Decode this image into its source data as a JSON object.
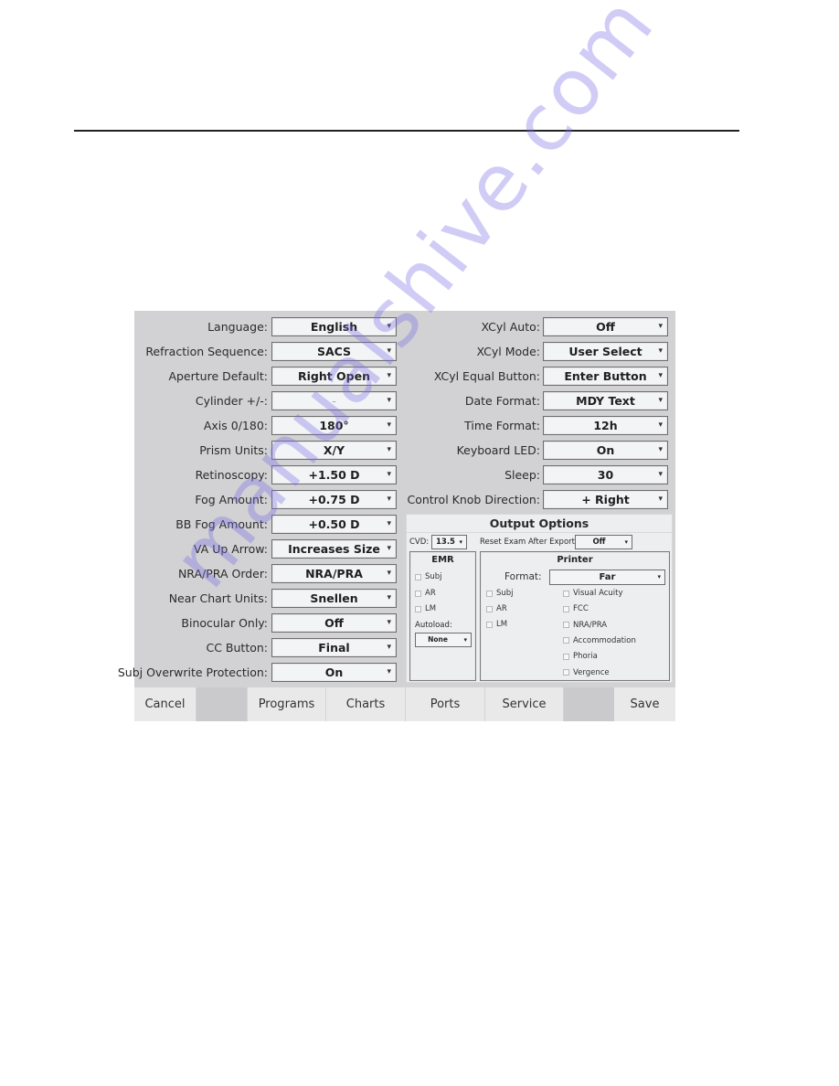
{
  "left_settings": [
    {
      "label": "Language:",
      "value": "English"
    },
    {
      "label": "Refraction Sequence:",
      "value": "SACS"
    },
    {
      "label": "Aperture Default:",
      "value": "Right Open"
    },
    {
      "label": "Cylinder +/-:",
      "value": "-",
      "disabled": true
    },
    {
      "label": "Axis 0/180:",
      "value": "180°"
    },
    {
      "label": "Prism Units:",
      "value": "X/Y"
    },
    {
      "label": "Retinoscopy:",
      "value": "+1.50 D"
    },
    {
      "label": "Fog Amount:",
      "value": "+0.75 D"
    },
    {
      "label": "BB Fog Amount:",
      "value": "+0.50 D"
    },
    {
      "label": "VA Up Arrow:",
      "value": "Increases Size"
    },
    {
      "label": "NRA/PRA Order:",
      "value": "NRA/PRA"
    },
    {
      "label": "Near Chart Units:",
      "value": "Snellen"
    },
    {
      "label": "Binocular Only:",
      "value": "Off"
    },
    {
      "label": "CC Button:",
      "value": "Final"
    },
    {
      "label": "Subj Overwrite Protection:",
      "value": "On"
    }
  ],
  "right_settings": [
    {
      "label": "XCyl Auto:",
      "value": "Off"
    },
    {
      "label": "XCyl Mode:",
      "value": "User Select"
    },
    {
      "label": "XCyl Equal Button:",
      "value": "Enter Button"
    },
    {
      "label": "Date Format:",
      "value": "MDY Text"
    },
    {
      "label": "Time Format:",
      "value": "12h"
    },
    {
      "label": "Keyboard LED:",
      "value": "On"
    },
    {
      "label": "Sleep:",
      "value": "30"
    },
    {
      "label": "Control Knob Direction:",
      "value": "+ Right"
    }
  ],
  "output_options": {
    "title": "Output Options",
    "cvd_label": "CVD:",
    "cvd_value": "13.5",
    "reset_label": "Reset Exam After Export:",
    "reset_value": "Off",
    "emr": {
      "title": "EMR",
      "checkboxes": [
        "Subj",
        "AR",
        "LM"
      ],
      "autoload_label": "Autoload:",
      "autoload_value": "None"
    },
    "printer": {
      "title": "Printer",
      "format_label": "Format:",
      "format_value": "Far",
      "col1": [
        "Subj",
        "AR",
        "LM"
      ],
      "col2": [
        "Visual Acuity",
        "FCC",
        "NRA/PRA",
        "Accommodation",
        "Phoria",
        "Vergence"
      ]
    }
  },
  "buttons": {
    "cancel": "Cancel",
    "programs": "Programs",
    "charts": "Charts",
    "ports": "Ports",
    "service": "Service",
    "save": "Save"
  },
  "dropdown_arrow": "▾",
  "watermark": "manualshive.com"
}
